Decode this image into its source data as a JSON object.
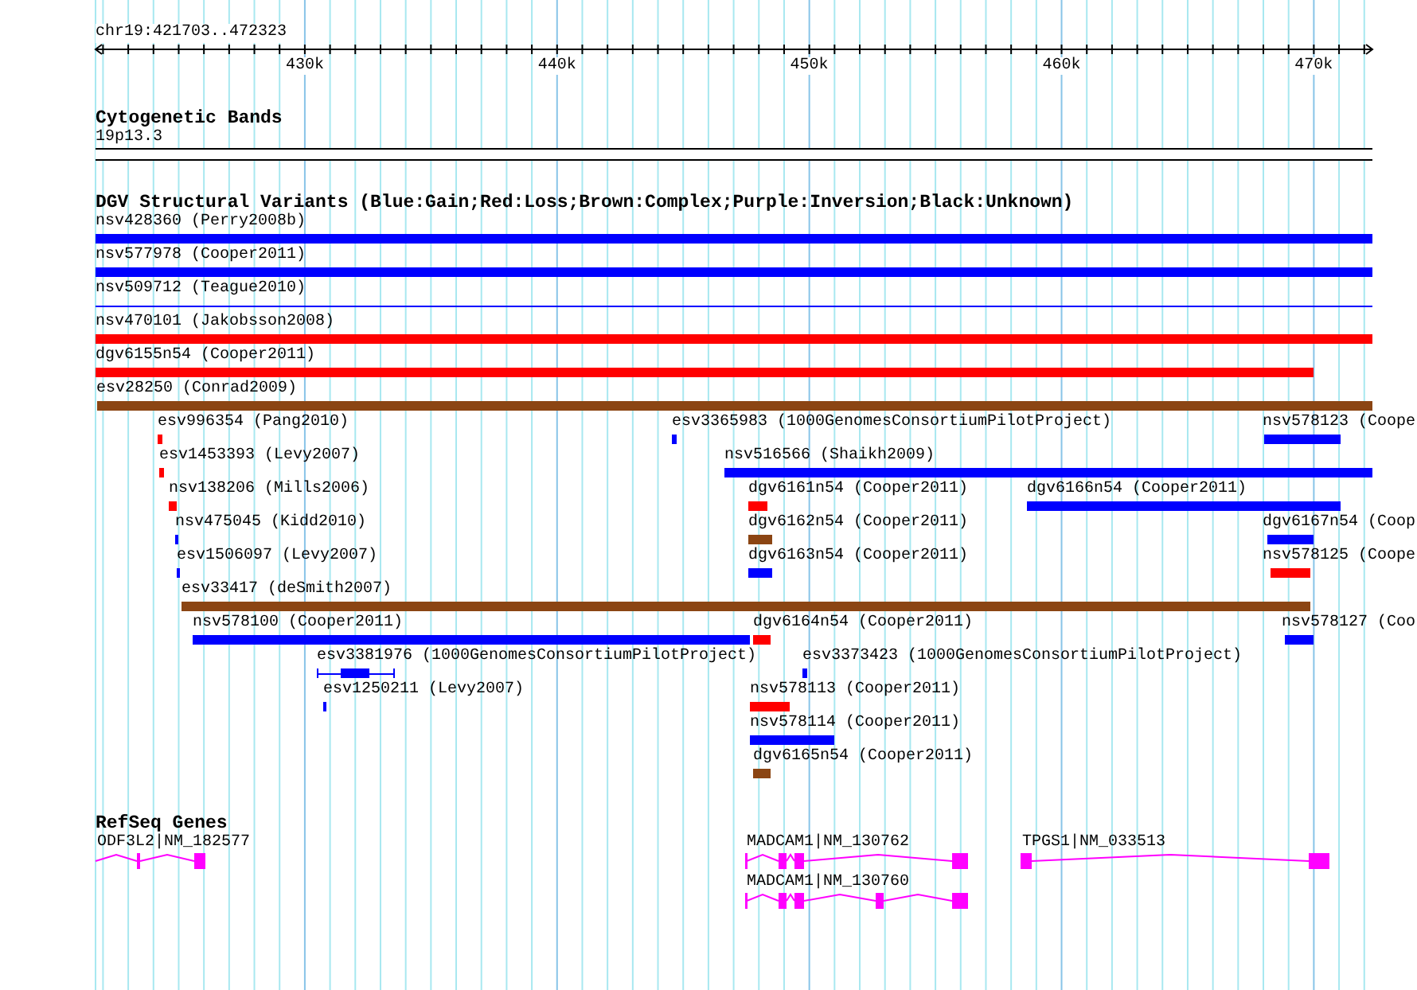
{
  "ruler": {
    "label": "chr19:421703..472323",
    "ticks": [
      "430k",
      "440k",
      "450k",
      "460k",
      "470k"
    ]
  },
  "cytoband": {
    "title": "Cytogenetic Bands",
    "band": "19p13.3"
  },
  "variants": {
    "title": "DGV Structural Variants (Blue:Gain;Red:Loss;Brown:Complex;Purple:Inversion;Black:Unknown)",
    "items": [
      {
        "label": "nsv428360 (Perry2008b)",
        "color": "#0000ff",
        "kind": "bar"
      },
      {
        "label": "nsv577978 (Cooper2011)",
        "color": "#0000ff",
        "kind": "bar"
      },
      {
        "label": "nsv509712 (Teague2010)",
        "color": "#0000ff",
        "kind": "line"
      },
      {
        "label": "nsv470101 (Jakobsson2008)",
        "color": "#ff0000",
        "kind": "bar"
      },
      {
        "label": "dgv6155n54 (Cooper2011)",
        "color": "#ff0000",
        "kind": "bar"
      },
      {
        "label": "esv28250 (Conrad2009)",
        "color": "#8b4513",
        "kind": "bar"
      },
      {
        "label": "esv996354 (Pang2010)",
        "color": "#ff0000",
        "kind": "bar"
      },
      {
        "label": "esv3365983 (1000GenomesConsortiumPilotProject)",
        "color": "#0000ff",
        "kind": "bar"
      },
      {
        "label": "nsv578123 (Coope",
        "color": "#0000ff",
        "kind": "bar"
      },
      {
        "label": "esv1453393 (Levy2007)",
        "color": "#ff0000",
        "kind": "bar"
      },
      {
        "label": "nsv516566 (Shaikh2009)",
        "color": "#0000ff",
        "kind": "bar"
      },
      {
        "label": "nsv138206 (Mills2006)",
        "color": "#ff0000",
        "kind": "bar"
      },
      {
        "label": "dgv6161n54 (Cooper2011)",
        "color": "#ff0000",
        "kind": "bar"
      },
      {
        "label": "dgv6166n54 (Cooper2011)",
        "color": "#0000ff",
        "kind": "bar"
      },
      {
        "label": "nsv475045 (Kidd2010)",
        "color": "#0000ff",
        "kind": "bar"
      },
      {
        "label": "dgv6162n54 (Cooper2011)",
        "color": "#8b4513",
        "kind": "bar"
      },
      {
        "label": "dgv6167n54 (Coop",
        "color": "#0000ff",
        "kind": "bar"
      },
      {
        "label": "esv1506097 (Levy2007)",
        "color": "#0000ff",
        "kind": "bar"
      },
      {
        "label": "dgv6163n54 (Cooper2011)",
        "color": "#0000ff",
        "kind": "bar"
      },
      {
        "label": "nsv578125 (Coope",
        "color": "#ff0000",
        "kind": "bar"
      },
      {
        "label": "esv33417 (deSmith2007)",
        "color": "#8b4513",
        "kind": "bar"
      },
      {
        "label": "nsv578100 (Cooper2011)",
        "color": "#0000ff",
        "kind": "bar"
      },
      {
        "label": "dgv6164n54 (Cooper2011)",
        "color": "#ff0000",
        "kind": "bar"
      },
      {
        "label": "nsv578127 (Coo",
        "color": "#0000ff",
        "kind": "bar"
      },
      {
        "label": "esv3381976 (1000GenomesConsortiumPilotProject)",
        "color": "#0000ff",
        "kind": "gapped"
      },
      {
        "label": "esv3373423 (1000GenomesConsortiumPilotProject)",
        "color": "#0000ff",
        "kind": "bar"
      },
      {
        "label": "esv1250211 (Levy2007)",
        "color": "#0000ff",
        "kind": "bar"
      },
      {
        "label": "nsv578113 (Cooper2011)",
        "color": "#ff0000",
        "kind": "bar"
      },
      {
        "label": "nsv578114 (Cooper2011)",
        "color": "#0000ff",
        "kind": "bar"
      },
      {
        "label": "dgv6165n54 (Cooper2011)",
        "color": "#8b4513",
        "kind": "bar"
      }
    ]
  },
  "genes": {
    "title": "RefSeq Genes",
    "items": [
      {
        "label": "ODF3L2|NM_182577"
      },
      {
        "label": "MADCAM1|NM_130762"
      },
      {
        "label": "TPGS1|NM_033513"
      },
      {
        "label": "MADCAM1|NM_130760"
      }
    ]
  }
}
